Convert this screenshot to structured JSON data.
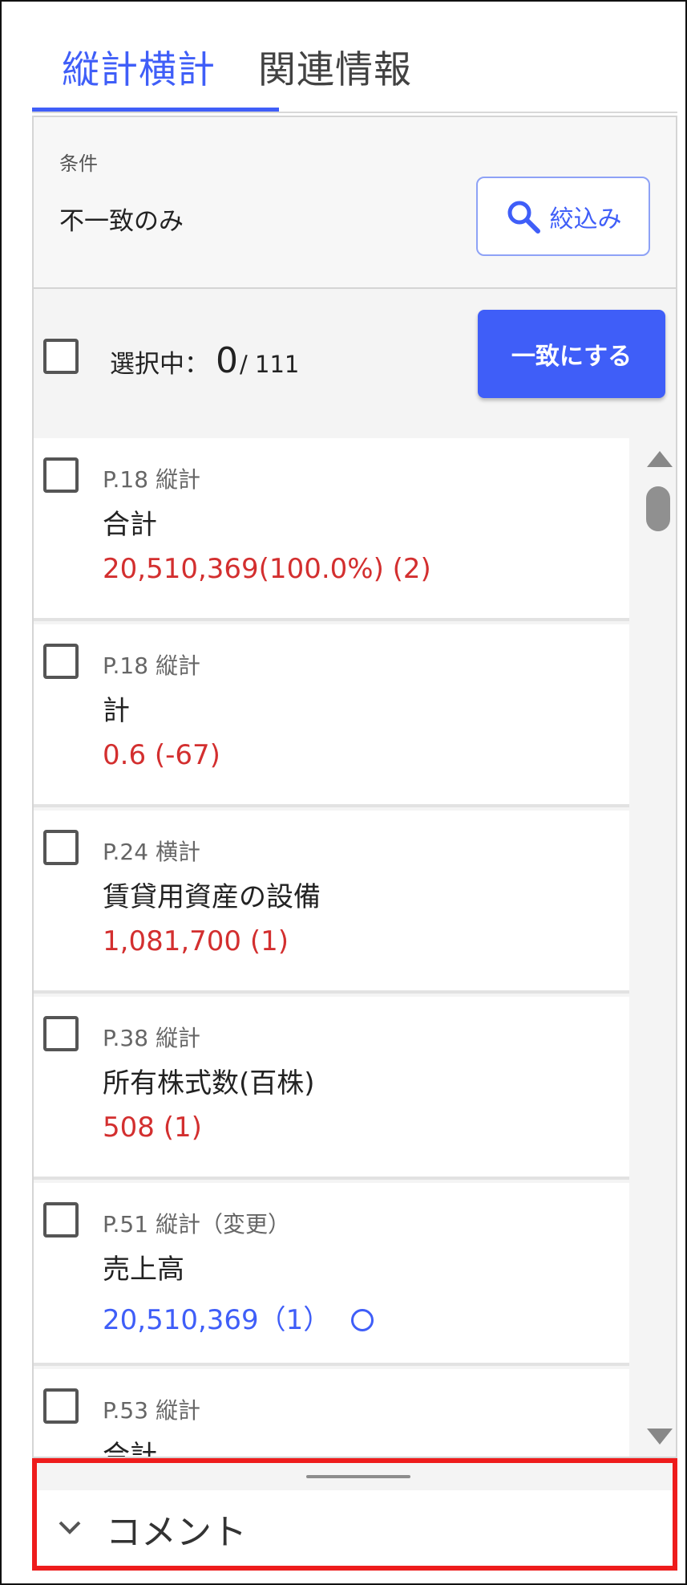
{
  "tabs": [
    {
      "label": "縦計横計",
      "active": true
    },
    {
      "label": "関連情報",
      "active": false
    }
  ],
  "filter": {
    "condition_label": "条件",
    "condition_value": "不一致のみ",
    "button_label": "絞込み"
  },
  "selection": {
    "label": "選択中：",
    "count": "0",
    "total": "/ 111",
    "match_button_label": "一致にする"
  },
  "items": [
    {
      "location": "P.18 縦計",
      "name": "合計",
      "value": "20,510,369(100.0%) (2)",
      "status_color": "red"
    },
    {
      "location": "P.18 縦計",
      "name": "計",
      "value": "0.6 (-67)",
      "status_color": "red"
    },
    {
      "location": "P.24 横計",
      "name": "賃貸用資産の設備",
      "value": "1,081,700 (1)",
      "status_color": "red"
    },
    {
      "location": "P.38 縦計",
      "name": "所有株式数(百株)",
      "value": "508 (1)",
      "status_color": "red"
    },
    {
      "location": "P.51 縦計（変更）",
      "name": "売上高",
      "value": "20,510,369（1）",
      "status_color": "blue",
      "match_icon": "circle-ok-icon"
    },
    {
      "location": "P.53 縦計",
      "name": "合計",
      "value": "",
      "status_color": "red"
    }
  ],
  "comment": {
    "label": "コメント"
  },
  "colors": {
    "accent": "#3f5ef8",
    "mismatch": "#d32f2f",
    "highlight_border": "#ee1c1c"
  }
}
